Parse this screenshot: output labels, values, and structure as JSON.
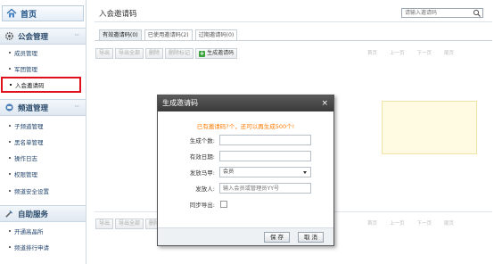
{
  "sidebar": {
    "home": {
      "label": "首页",
      "icon": "home-icon"
    },
    "sections": [
      {
        "title": "公会管理",
        "icon": "gear-icon",
        "more": "···",
        "items": [
          {
            "label": "成员管理"
          },
          {
            "label": "军团管理"
          },
          {
            "label": "入会邀请码",
            "active": true
          }
        ]
      },
      {
        "title": "频道管理",
        "icon": "channel-icon",
        "more": "···",
        "items": [
          {
            "label": "子频道管理"
          },
          {
            "label": "黑名单管理"
          },
          {
            "label": "操作日志"
          },
          {
            "label": "权限管理"
          },
          {
            "label": "频道安全设置"
          }
        ]
      },
      {
        "title": "自助服务",
        "icon": "tools-icon",
        "more": "",
        "items": [
          {
            "label": "开通高晶所"
          },
          {
            "label": "频道排行申请"
          }
        ]
      }
    ]
  },
  "main": {
    "title": "入会邀请码",
    "search": {
      "placeholder": "请输入邀请码"
    },
    "tabs": [
      {
        "label": "有效邀请码(0)",
        "active": true
      },
      {
        "label": "已使用邀请码(2)",
        "active": false
      },
      {
        "label": "过期邀请码(0)",
        "active": false
      }
    ],
    "toolbar": {
      "buttons": [
        "导出",
        "导出全部",
        "删除",
        "删除标记"
      ],
      "generate": "生成邀请码"
    },
    "pager": [
      "首页",
      "上一页",
      "下一页",
      "尾页"
    ],
    "bottom_toolbar": {
      "buttons": [
        "导出",
        "导出全部",
        "删除"
      ]
    }
  },
  "dialog": {
    "title": "生成邀请码",
    "close": "×",
    "notice": "已有邀请码?个，还可以再生成500个!",
    "fields": {
      "count_label": "生成个数:",
      "count_value": "",
      "expiry_label": "有效日期:",
      "expiry_value": "",
      "rank_label": "发放马甲:",
      "rank_value": "会员",
      "issuer_label": "发放人:",
      "issuer_placeholder": "输入会员或管理员YY号",
      "sync_label": "同步导出:"
    },
    "save": "保 存",
    "cancel": "取 消"
  }
}
